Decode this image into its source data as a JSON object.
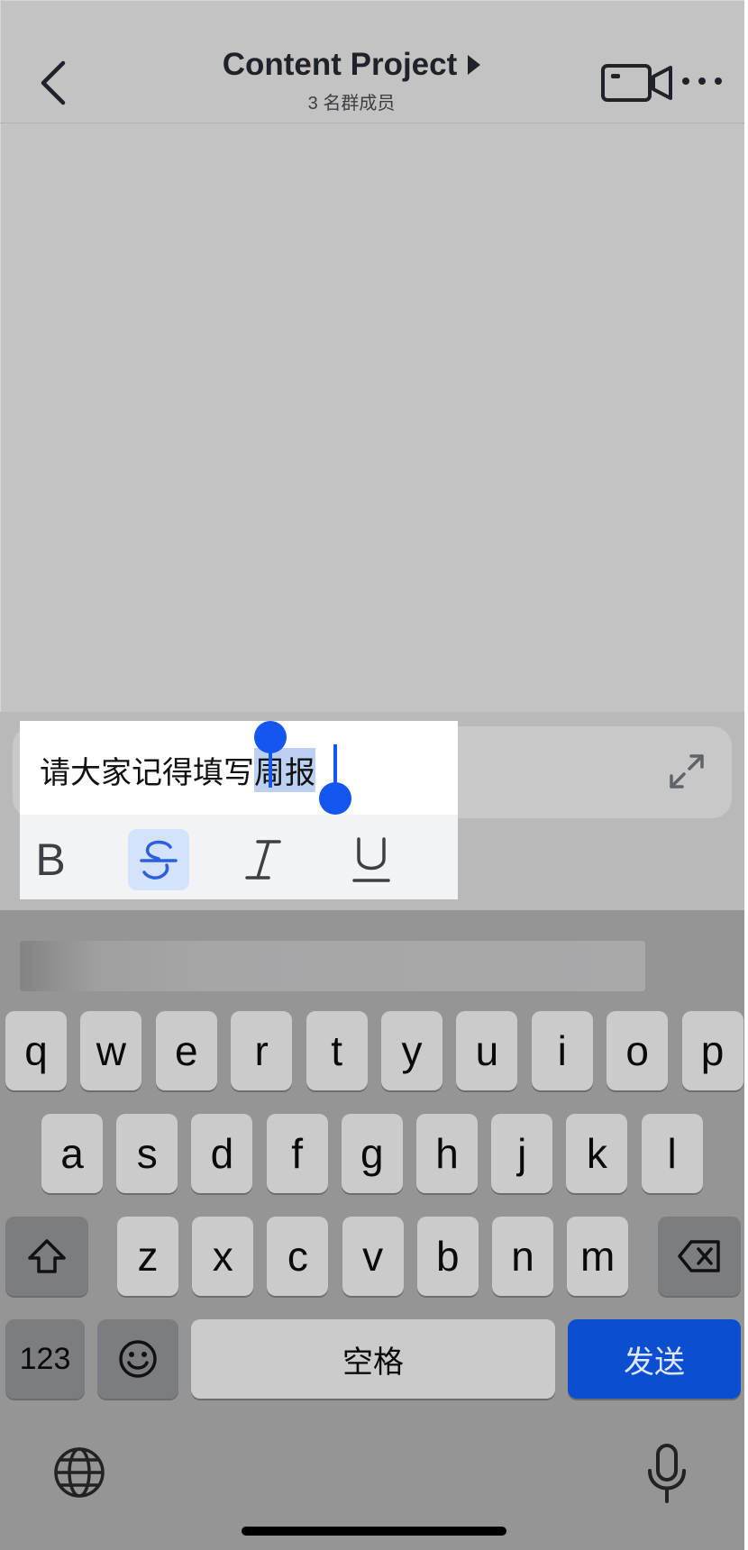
{
  "header": {
    "back_icon": "chevron-left-icon",
    "title": "Content Project",
    "subtitle": "3 名群成员",
    "video_icon": "video-camera-icon",
    "more_icon": "more-horizontal-icon"
  },
  "composer": {
    "text_before_selection": "请大家记得填写",
    "selected_text": "周报",
    "expand_icon": "expand-icon",
    "selection_color": "#1456f0"
  },
  "format_toolbar": {
    "bold_label": "B",
    "strikethrough_icon": "strikethrough-icon",
    "italic_icon": "italic-icon",
    "underline_icon": "underline-icon",
    "active": "strikethrough"
  },
  "keyboard": {
    "row1": [
      "q",
      "w",
      "e",
      "r",
      "t",
      "y",
      "u",
      "i",
      "o",
      "p"
    ],
    "row2": [
      "a",
      "s",
      "d",
      "f",
      "g",
      "h",
      "j",
      "k",
      "l"
    ],
    "row3": [
      "z",
      "x",
      "c",
      "v",
      "b",
      "n",
      "m"
    ],
    "shift_icon": "shift-icon",
    "delete_icon": "backspace-icon",
    "numbers_label": "123",
    "emoji_icon": "emoji-icon",
    "space_label": "空格",
    "send_label": "发送",
    "globe_icon": "globe-icon",
    "mic_icon": "microphone-icon",
    "send_color": "#0b4fd0"
  }
}
